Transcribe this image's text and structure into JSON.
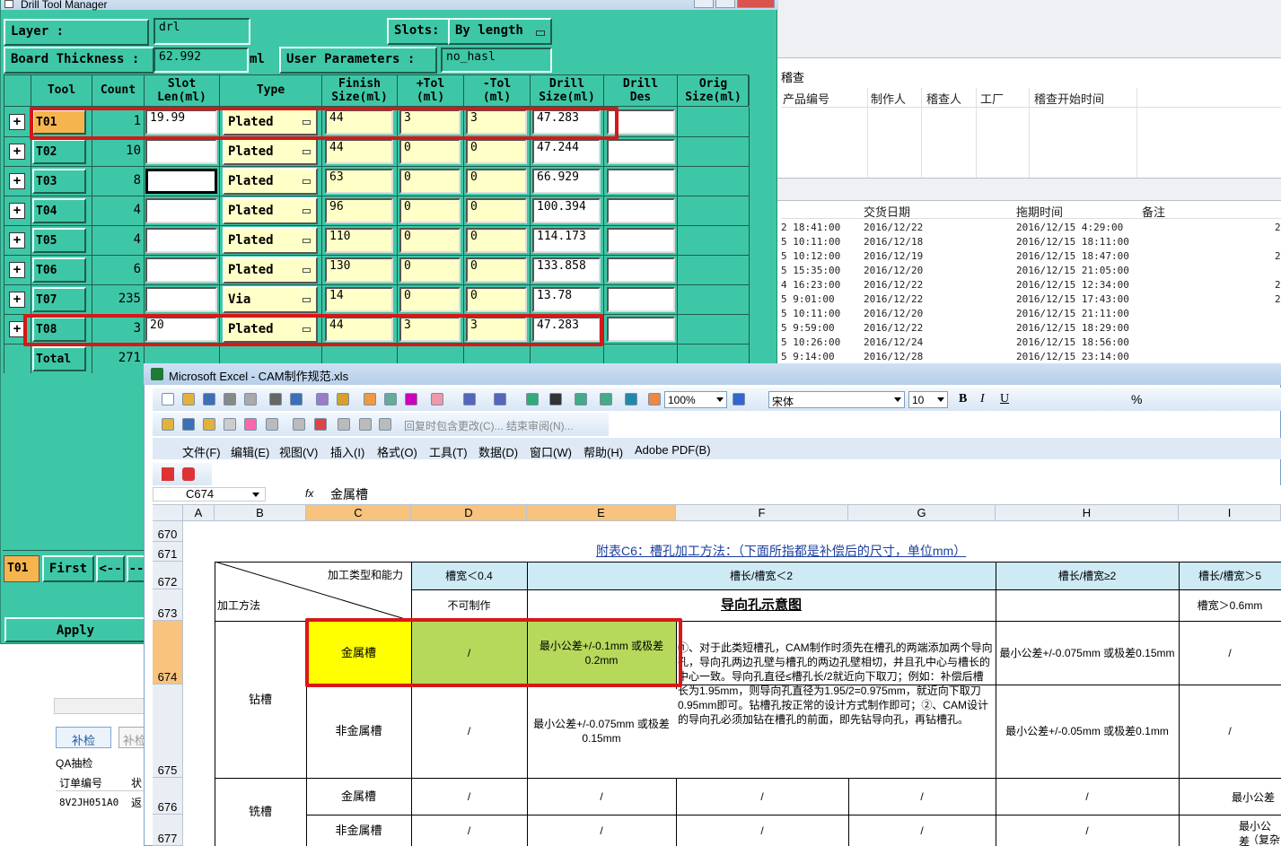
{
  "bg_window": {
    "header1": "稽查",
    "header2": [
      "产品编号",
      "制作人",
      "稽查人",
      "工厂",
      "稽查开始时间"
    ],
    "header3": [
      "交货日期",
      "拖期时间",
      "备注"
    ],
    "rows": [
      [
        "2 18:41:00",
        "2016/12/22",
        "2016/12/15 4:29:00",
        "2"
      ],
      [
        "5 10:11:00",
        "2016/12/18",
        "2016/12/15 18:11:00",
        ""
      ],
      [
        "5 10:12:00",
        "2016/12/19",
        "2016/12/15 18:47:00",
        "2"
      ],
      [
        "5 15:35:00",
        "2016/12/20",
        "2016/12/15 21:05:00",
        ""
      ],
      [
        "4 16:23:00",
        "2016/12/22",
        "2016/12/15 12:34:00",
        "2"
      ],
      [
        "5 9:01:00",
        "2016/12/22",
        "2016/12/15 17:43:00",
        "2"
      ],
      [
        "5 10:11:00",
        "2016/12/20",
        "2016/12/15 21:11:00",
        ""
      ],
      [
        "5 9:59:00",
        "2016/12/22",
        "2016/12/15 18:29:00",
        ""
      ],
      [
        "5 10:26:00",
        "2016/12/24",
        "2016/12/15 18:56:00",
        ""
      ],
      [
        "5 9:14:00",
        "2016/12/28",
        "2016/12/15 23:14:00",
        ""
      ]
    ],
    "bottom_left": {
      "btn1": "补检",
      "btn2": "补检",
      "qa_label": "QA抽检",
      "col1": "订单编号",
      "col2": "状",
      "order": "8V2JH051A0",
      "status": "返"
    }
  },
  "dtm": {
    "title": "Drill Tool Manager",
    "layer_label": "Layer      :",
    "layer_value": "drl",
    "slots_label": "Slots:",
    "slots_value": "By length",
    "thickness_label": "Board Thickness :",
    "thickness_value": "62.992",
    "thickness_unit": "ml",
    "user_params_label": "User Parameters :",
    "user_params_value": "no_hasl",
    "headers": [
      "Tool",
      "Count",
      "Slot\nLen(ml)",
      "Type",
      "Finish\nSize(ml)",
      "+Tol\n(ml)",
      "-Tol\n(ml)",
      "Drill\nSize(ml)",
      "Drill\nDes",
      "Orig\nSize(ml)"
    ],
    "rows": [
      {
        "tool": "T01",
        "count": "1",
        "slot": "19.99",
        "type": "Plated",
        "finish": "44",
        "ptol": "3",
        "mtol": "3",
        "drill": "47.283"
      },
      {
        "tool": "T02",
        "count": "10",
        "slot": "",
        "type": "Plated",
        "finish": "44",
        "ptol": "0",
        "mtol": "0",
        "drill": "47.244"
      },
      {
        "tool": "T03",
        "count": "8",
        "slot": "",
        "type": "Plated",
        "finish": "63",
        "ptol": "0",
        "mtol": "0",
        "drill": "66.929"
      },
      {
        "tool": "T04",
        "count": "4",
        "slot": "",
        "type": "Plated",
        "finish": "96",
        "ptol": "0",
        "mtol": "0",
        "drill": "100.394"
      },
      {
        "tool": "T05",
        "count": "4",
        "slot": "",
        "type": "Plated",
        "finish": "110",
        "ptol": "0",
        "mtol": "0",
        "drill": "114.173"
      },
      {
        "tool": "T06",
        "count": "6",
        "slot": "",
        "type": "Plated",
        "finish": "130",
        "ptol": "0",
        "mtol": "0",
        "drill": "133.858"
      },
      {
        "tool": "T07",
        "count": "235",
        "slot": "",
        "type": "Via",
        "finish": "14",
        "ptol": "0",
        "mtol": "0",
        "drill": "13.78"
      },
      {
        "tool": "T08",
        "count": "3",
        "slot": "20",
        "type": "Plated",
        "finish": "44",
        "ptol": "3",
        "mtol": "3",
        "drill": "47.283"
      }
    ],
    "total_label": "Total",
    "total_value": "271",
    "current_tool": "T01",
    "first_btn": "First",
    "prev_btn": "<--",
    "next_btn": "--",
    "apply_btn": "Apply"
  },
  "excel": {
    "title": "Microsoft Excel - CAM制作规范.xls",
    "zoom": "100%",
    "font": "宋体",
    "size": "10",
    "review_text": "回复时包含更改(C)... 结束审阅(N)...",
    "menus": [
      "文件(F)",
      "编辑(E)",
      "视图(V)",
      "插入(I)",
      "格式(O)",
      "工具(T)",
      "数据(D)",
      "窗口(W)",
      "帮助(H)",
      "Adobe PDF(B)"
    ],
    "cell_ref": "C674",
    "fx": "fx",
    "formula": "金属槽",
    "cols": [
      "A",
      "B",
      "C",
      "D",
      "E",
      "F",
      "G",
      "H",
      "I"
    ],
    "rows": [
      "670",
      "671",
      "672",
      "673",
      "674",
      "675",
      "676",
      "677"
    ],
    "sheet": {
      "title": "附表C6：槽孔加工方法：（下面所指都是补偿后的尺寸，单位mm）",
      "h_type": "加工类型和能力",
      "h_method": "加工方法",
      "h_d": "槽宽＜0.4",
      "h_ef": "槽长/槽宽＜2",
      "h_h": "槽长/槽宽≥2",
      "h_i": "槽长/槽宽＞5",
      "cannot": "不可制作",
      "guide": "导向孔示意图",
      "i673": "槽宽＞0.6mm",
      "drill": "钻槽",
      "mill": "铣槽",
      "metal": "金属槽",
      "nonmetal": "非金属槽",
      "slash": "/",
      "e674": "最小公差+/-0.1mm 或极差0.2mm",
      "e675": "最小公差+/-0.075mm 或极差0.15mm",
      "f674": "①、对于此类短槽孔，CAM制作时须先在槽孔的两端添加两个导向孔，导向孔两边孔壁与槽孔的两边孔壁相切，并且孔中心与槽长的中心一致。导向孔直径≤槽孔长/2就近向下取刀；例如：补偿后槽长为1.95mm，则导向孔直径为1.95/2=0.975mm，就近向下取刀0.95mm即可。钻槽孔按正常的设计方式制作即可；②、CAM设计的导向孔必须加钻在槽孔的前面，即先钻导向孔，再钻槽孔。",
      "h674": "最小公差+/-0.075mm 或极差0.15mm",
      "h675": "最小公差+/-0.05mm 或极差0.1mm",
      "i676": "最小公差",
      "i677a": "最小公差",
      "i677b": "（复杂"
    }
  }
}
